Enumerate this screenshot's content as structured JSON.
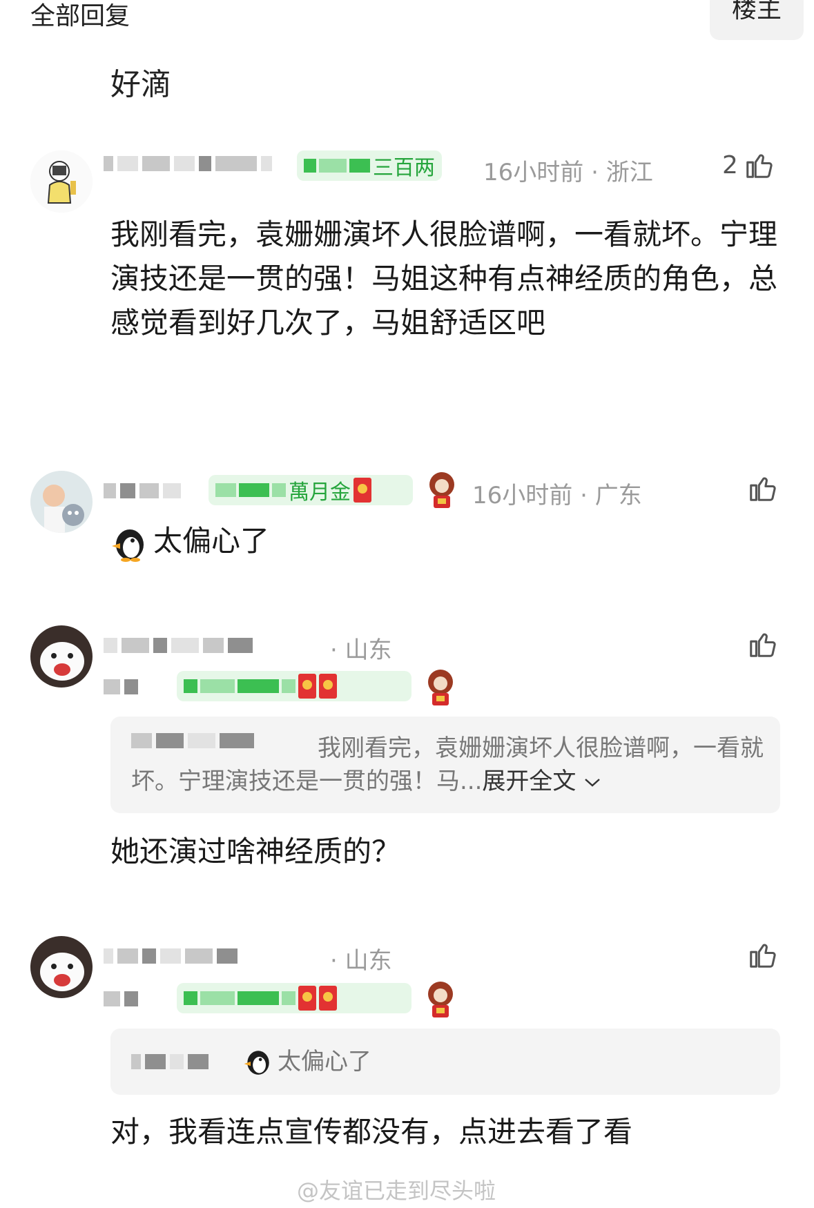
{
  "header": {
    "title": "全部回复",
    "owner_button": "楼主"
  },
  "top_reply": {
    "text": "好滴"
  },
  "comments": [
    {
      "badge_text": "三百两",
      "time": "16小时前",
      "location": "浙江",
      "likes": "2",
      "text": "我刚看完，袁姗姗演坏人很脸谱啊，一看就坏。宁理演技还是一贯的强！马姐这种有点神经质的角色，总感觉看到好几次了，马姐舒适区吧"
    },
    {
      "badge_text": "萬月金",
      "time": "16小时前",
      "location": "广东",
      "emoji": "penguin-emoji",
      "text": "太偏心了"
    },
    {
      "location": "山东",
      "quote_text": "我刚看完，袁姗姗演坏人很脸谱啊，一看就坏。宁理演技还是一贯的强！马...",
      "quote_expand": "展开全文",
      "text": "她还演过啥神经质的？"
    },
    {
      "location": "山东",
      "quote_text": "太偏心了",
      "text": "对，我看连点宣传都没有，点进去看了看"
    }
  ],
  "watermark": "@友谊已走到尽头啦",
  "colors": {
    "badge_green": "#25a53c",
    "meta_gray": "#9a9a9a",
    "quote_bg": "#f4f4f4"
  }
}
